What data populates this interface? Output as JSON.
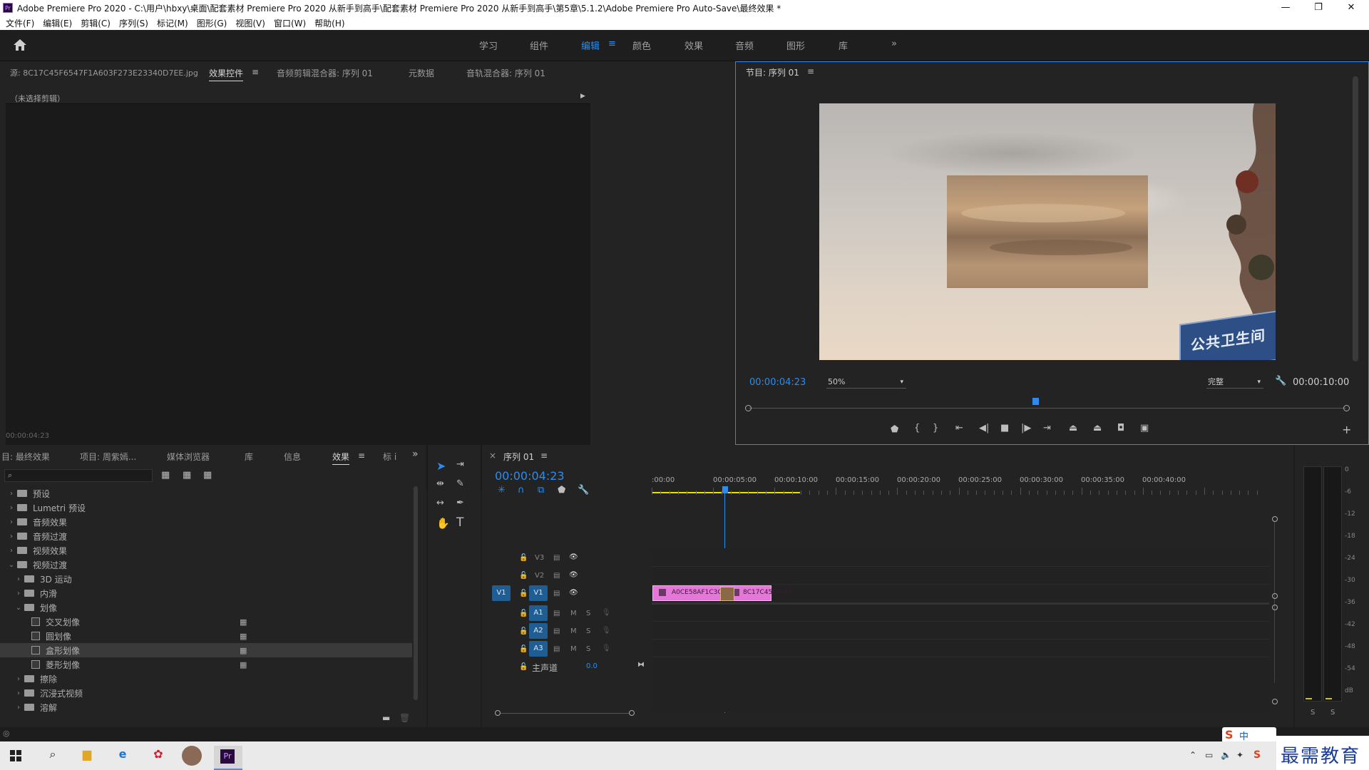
{
  "window": {
    "app_icon": "Pr",
    "title": "Adobe Premiere Pro 2020 - C:\\用户\\hbxy\\桌面\\配套素材 Premiere Pro 2020 从新手到高手\\配套素材 Premiere Pro 2020 从新手到高手\\第5章\\5.1.2\\Adobe Premiere Pro Auto-Save\\最终效果 *",
    "controls": [
      "—",
      "❐",
      "✕"
    ]
  },
  "menu": [
    "文件(F)",
    "编辑(E)",
    "剪辑(C)",
    "序列(S)",
    "标记(M)",
    "图形(G)",
    "视图(V)",
    "窗口(W)",
    "帮助(H)"
  ],
  "workspaces": {
    "items": [
      "学习",
      "组件",
      "编辑",
      "颜色",
      "效果",
      "音频",
      "图形",
      "库"
    ],
    "active": "编辑",
    "more": "»"
  },
  "source_panel": {
    "tabs": [
      "源: 8C17C45F6547F1A603F273E23340D7EE.jpg",
      "效果控件",
      "音频剪辑混合器: 序列 01",
      "元数据",
      "音轨混合器: 序列 01"
    ],
    "active_tab": "效果控件",
    "no_clip": "（未选择剪辑）",
    "timecode": "00:00:04:23"
  },
  "program_monitor": {
    "title": "节目: 序列 01",
    "timecode": "00:00:04:23",
    "zoom": "50%",
    "quality": "完整",
    "duration": "00:00:10:00",
    "playhead_fraction": 0.48,
    "sign_text": "公共卫生间"
  },
  "project_panel": {
    "tabs": [
      "目: 最终效果",
      "项目: 周紫嫣...",
      "媒体浏览器",
      "库",
      "信息",
      "效果",
      "标 i"
    ],
    "active_tab": "效果",
    "search_placeholder": "",
    "tree": [
      {
        "label": "预设",
        "level": 0,
        "type": "folder",
        "expanded": false
      },
      {
        "label": "Lumetri 预设",
        "level": 0,
        "type": "folder",
        "expanded": false
      },
      {
        "label": "音频效果",
        "level": 0,
        "type": "folder",
        "expanded": false
      },
      {
        "label": "音频过渡",
        "level": 0,
        "type": "folder",
        "expanded": false
      },
      {
        "label": "视频效果",
        "level": 0,
        "type": "folder",
        "expanded": false
      },
      {
        "label": "视频过渡",
        "level": 0,
        "type": "folder",
        "expanded": true
      },
      {
        "label": "3D 运动",
        "level": 1,
        "type": "folder",
        "expanded": false
      },
      {
        "label": "内滑",
        "level": 1,
        "type": "folder",
        "expanded": false
      },
      {
        "label": "划像",
        "level": 1,
        "type": "folder",
        "expanded": true
      },
      {
        "label": "交叉划像",
        "level": 2,
        "type": "effect",
        "selected": false
      },
      {
        "label": "圆划像",
        "level": 2,
        "type": "effect",
        "selected": false
      },
      {
        "label": "盒形划像",
        "level": 2,
        "type": "effect",
        "selected": true
      },
      {
        "label": "菱形划像",
        "level": 2,
        "type": "effect",
        "selected": false
      },
      {
        "label": "擦除",
        "level": 1,
        "type": "folder",
        "expanded": false
      },
      {
        "label": "沉浸式视频",
        "level": 1,
        "type": "folder",
        "expanded": false
      },
      {
        "label": "溶解",
        "level": 1,
        "type": "folder",
        "expanded": false
      }
    ]
  },
  "timeline": {
    "title": "序列 01",
    "timecode": "00:00:04:23",
    "ruler": [
      ":00:00",
      "00:00:05:00",
      "00:00:10:00",
      "00:00:15:00",
      "00:00:20:00",
      "00:00:25:00",
      "00:00:30:00",
      "00:00:35:00",
      "00:00:40:00"
    ],
    "video_tracks": [
      "V3",
      "V2",
      "V1"
    ],
    "audio_tracks": [
      "A1",
      "A2",
      "A3"
    ],
    "master_label": "主声道",
    "master_value": "0.0",
    "clip_a": "A0CE58AF1C3C",
    "clip_b": "8C17C45F6547",
    "mute": "M",
    "solo": "S"
  },
  "meter": {
    "scale": [
      "0",
      "-6",
      "-12",
      "-18",
      "-24",
      "-30",
      "-36",
      "-42",
      "-48",
      "-54",
      "dB"
    ],
    "solo": [
      "S",
      "S"
    ]
  },
  "watermark": "最需教育",
  "ime": "中"
}
